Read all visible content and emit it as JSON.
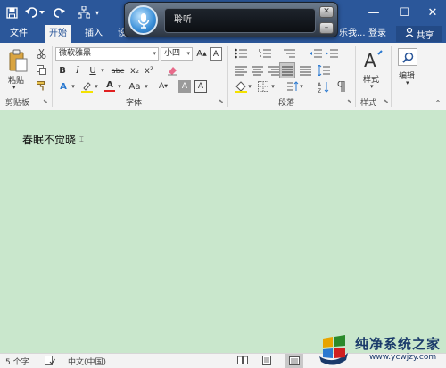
{
  "titlebar": {
    "window_controls": [
      "—",
      "☐",
      "✕"
    ],
    "colors": {
      "accent": "#2b579a"
    }
  },
  "tabs": {
    "file": "文件",
    "home": "开始",
    "insert": "插入",
    "partial": "设",
    "search_hint": "乐我...",
    "login": "登录",
    "share": "共享"
  },
  "ribbon": {
    "clipboard": {
      "paste": "粘贴",
      "label": "剪贴板"
    },
    "font": {
      "name": "微软雅黑",
      "size": "小四",
      "label": "字体",
      "buttons": [
        "B",
        "I",
        "U",
        "abc",
        "x₂",
        "x²"
      ],
      "case_button": "Aa"
    },
    "paragraph": {
      "label": "段落"
    },
    "styles": {
      "button": "样式",
      "label": "样式"
    },
    "editing": {
      "button": "编辑"
    }
  },
  "speech": {
    "status_text": "聆听"
  },
  "document": {
    "text": "春眠不觉晓",
    "background": "#c9e7cc"
  },
  "status": {
    "word_count": "5 个字",
    "language": "中文(中国)"
  },
  "watermark": {
    "title": "纯净系统之家",
    "url": "www.ycwjzy.com"
  }
}
